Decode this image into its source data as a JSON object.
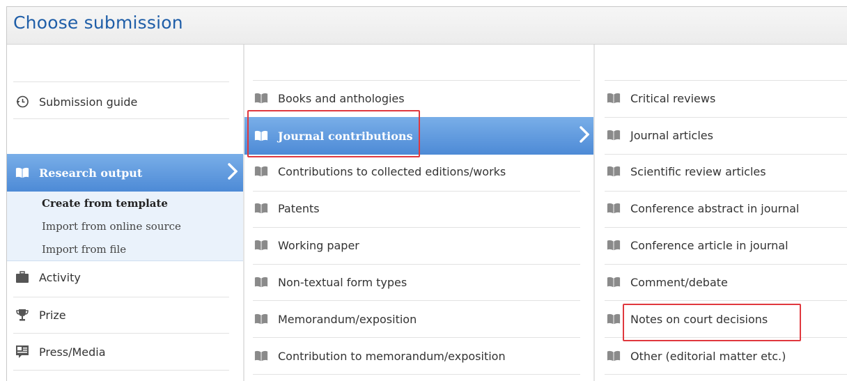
{
  "window": {
    "title": "Choose submission"
  },
  "left": {
    "submission_guide": "Submission guide",
    "selected": "Research output",
    "sub_items": [
      "Create from template",
      "Import from online source",
      "Import from file"
    ],
    "items": [
      "Activity",
      "Prize",
      "Press/Media"
    ]
  },
  "middle": {
    "items": [
      "Books and anthologies",
      "Journal contributions",
      "Contributions to collected editions/works",
      "Patents",
      "Working paper",
      "Non-textual form types",
      "Memorandum/exposition",
      "Contribution to memorandum/exposition"
    ],
    "selected_index": 1
  },
  "right": {
    "items": [
      "Critical reviews",
      "Journal articles",
      "Scientific review articles",
      "Conference abstract in journal",
      "Conference article in journal",
      "Comment/debate",
      "Notes on court decisions",
      "Other (editorial matter etc.)"
    ]
  },
  "colors": {
    "accent": "#4d8ad6",
    "title": "#1f5ea8",
    "highlight_box": "#e0383e",
    "icon_gray": "#8a8a8a"
  }
}
